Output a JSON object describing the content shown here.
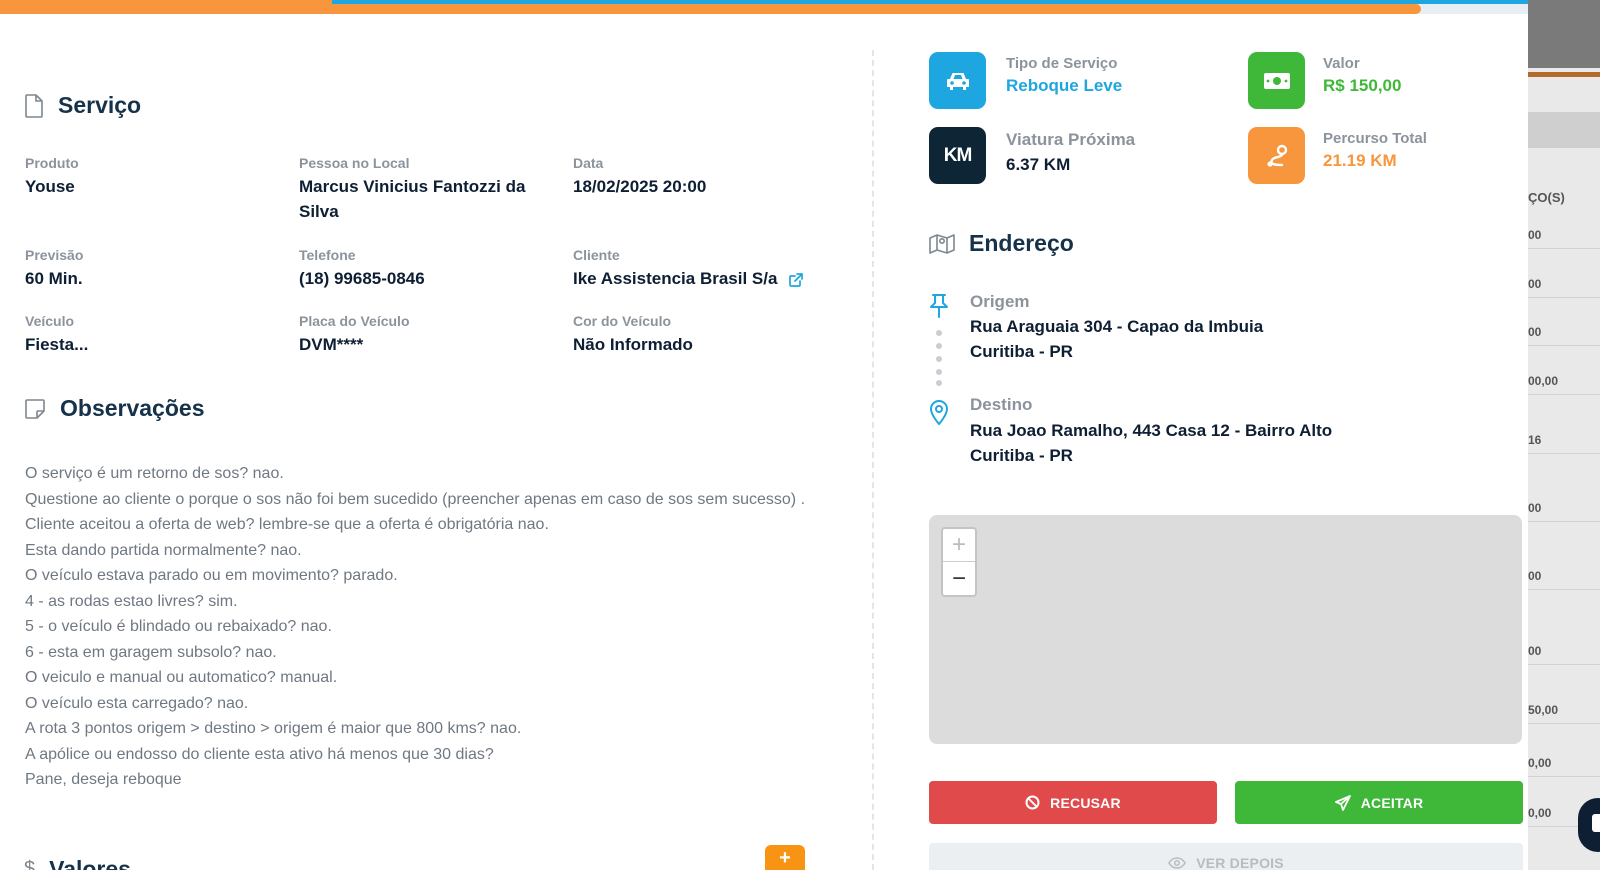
{
  "servico": {
    "title": "Serviço",
    "fields": {
      "produto": {
        "label": "Produto",
        "value": "Youse"
      },
      "pessoa": {
        "label": "Pessoa no Local",
        "value_line1": "Marcus Vinicius Fantozzi da",
        "value_line2": "Silva"
      },
      "data": {
        "label": "Data",
        "value": "18/02/2025 20:00"
      },
      "previsao": {
        "label": "Previsão",
        "value": "60 Min."
      },
      "telefone": {
        "label": "Telefone",
        "value": "(18) 99685-0846"
      },
      "cliente": {
        "label": "Cliente",
        "value": "Ike Assistencia Brasil S/a"
      },
      "veiculo": {
        "label": "Veículo",
        "value": "Fiesta..."
      },
      "placa": {
        "label": "Placa do Veículo",
        "value": "DVM****"
      },
      "cor": {
        "label": "Cor do Veículo",
        "value": "Não Informado"
      }
    }
  },
  "observacoes": {
    "title": "Observações",
    "lines": [
      "O serviço é um retorno de sos? nao.",
      "Questione ao cliente o porque o sos não foi bem sucedido (preencher apenas em caso de sos sem sucesso) .",
      "Cliente aceitou a oferta de web? lembre-se que a oferta é obrigatória nao.",
      "Esta dando partida normalmente? nao.",
      "O veículo estava parado ou em movimento? parado.",
      "4 - as rodas estao livres? sim.",
      "5 - o veículo é blindado ou rebaixado? nao.",
      "6 - esta em garagem subsolo? nao.",
      "O veiculo e manual ou automatico? manual.",
      "O veículo esta carregado? nao.",
      "A rota 3 pontos origem > destino > origem é maior que 800 kms? nao.",
      "A apólice ou endosso do cliente esta ativo há menos que 30 dias?",
      "Pane, deseja reboque"
    ]
  },
  "valores": {
    "title": "Valores",
    "add_label": "+"
  },
  "stats": {
    "tipo": {
      "label": "Tipo de Serviço",
      "value": "Reboque Leve"
    },
    "valor": {
      "label": "Valor",
      "value": "R$ 150,00"
    },
    "viatura": {
      "label": "Viatura Próxima",
      "value": "6.37 KM",
      "icon_text": "KM"
    },
    "percurso": {
      "label": "Percurso Total",
      "value": "21.19 KM"
    }
  },
  "endereco": {
    "title": "Endereço",
    "origem": {
      "label": "Origem",
      "line1": "Rua Araguaia 304 - Capao da Imbuia",
      "line2": "Curitiba - PR"
    },
    "destino": {
      "label": "Destino",
      "line1": "Rua Joao Ramalho, 443 Casa 12 - Bairro Alto",
      "line2": "Curitiba - PR"
    }
  },
  "map": {
    "zoom_in": "+",
    "zoom_out": "−"
  },
  "actions": {
    "refuse": "RECUSAR",
    "accept": "ACEITAR",
    "later": "VER DEPOIS"
  },
  "progress": {
    "fraction": 0.93
  },
  "background": {
    "header": "ÇO(S)",
    "cells": [
      "00",
      "00",
      "00",
      "00,00",
      "16",
      "00",
      "00",
      "00",
      "50,00",
      "0,00",
      "0,00"
    ]
  },
  "colors": {
    "accent_blue": "#1ea6e0",
    "accent_orange": "#f7963c",
    "accent_green": "#3fb83a",
    "danger_red": "#e04a4a",
    "dark_navy": "#0e1f33"
  }
}
